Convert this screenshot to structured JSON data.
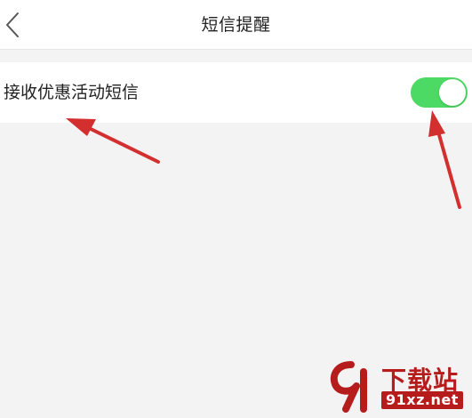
{
  "header": {
    "title": "短信提醒",
    "back_icon": "chevron-left-icon"
  },
  "settings": {
    "promo_sms": {
      "label": "接收优惠活动短信",
      "enabled": true
    }
  },
  "watermark": {
    "text": "下载站",
    "url": "91xz.net"
  },
  "colors": {
    "toggle_on": "#4cd964",
    "background": "#f3f3f3",
    "annotation_arrow": "#d32f2f",
    "watermark": "#b71c1c"
  }
}
